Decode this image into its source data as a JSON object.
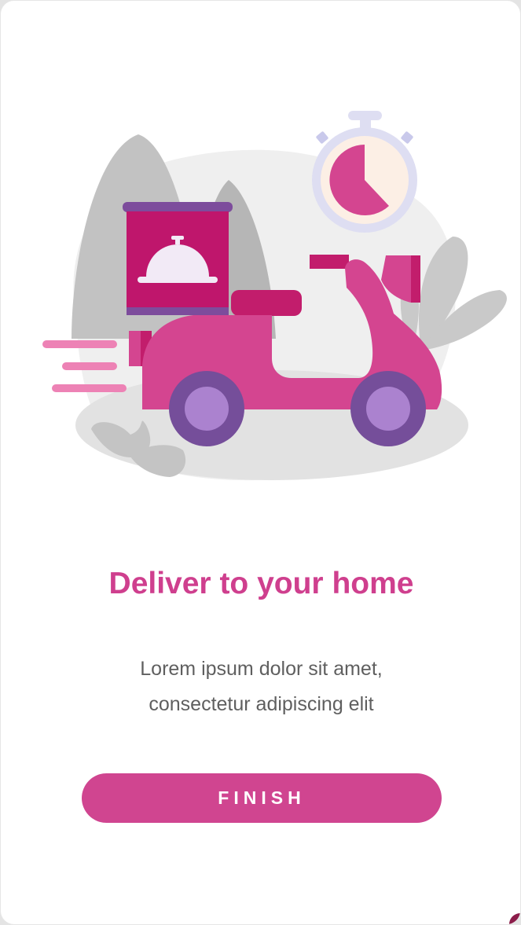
{
  "onboarding": {
    "title": "Deliver to your home",
    "description_line1": "Lorem ipsum dolor sit amet,",
    "description_line2": "consectetur adipiscing elit",
    "finish_label": "FINISH"
  },
  "colors": {
    "accent": "#d04590",
    "title": "#cf3f8e",
    "scooter_pink": "#d44590",
    "box_magenta": "#bf166c",
    "wheel_purple": "#754e9a",
    "hub_lilac": "#ab82cf",
    "foliage_gray": "#bdbdbd"
  },
  "icons": [
    "delivery-scooter-illustration",
    "stopwatch-icon",
    "food-cloche-icon"
  ]
}
